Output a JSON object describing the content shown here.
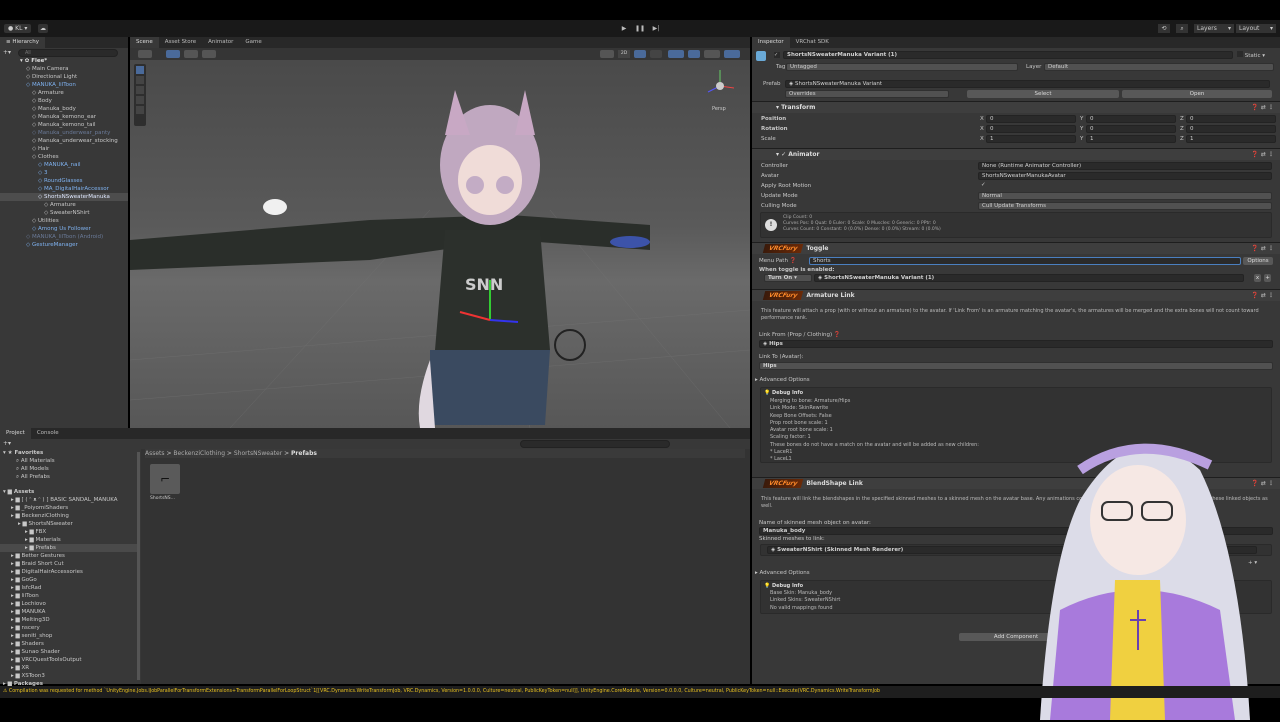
{
  "toolbar": {
    "account": "KL",
    "layers": "Layers",
    "layout": "Layout"
  },
  "hierarchy": {
    "title": "Hierarchy",
    "search_placeholder": "All",
    "scene": "Flee*",
    "items": [
      {
        "label": "Main Camera",
        "depth": 1,
        "kind": "object"
      },
      {
        "label": "Directional Light",
        "depth": 1,
        "kind": "object"
      },
      {
        "label": "MANUKA_lilToon",
        "depth": 1,
        "kind": "prefab"
      },
      {
        "label": "Armature",
        "depth": 2,
        "kind": "object"
      },
      {
        "label": "Body",
        "depth": 2,
        "kind": "object"
      },
      {
        "label": "Manuka_body",
        "depth": 2,
        "kind": "object"
      },
      {
        "label": "Manuka_kemono_ear",
        "depth": 2,
        "kind": "object"
      },
      {
        "label": "Manuka_kemono_tail",
        "depth": 2,
        "kind": "object"
      },
      {
        "label": "Manuka_underwear_panty",
        "depth": 2,
        "kind": "disabled"
      },
      {
        "label": "Manuka_underwear_stocking",
        "depth": 2,
        "kind": "object"
      },
      {
        "label": "Hair",
        "depth": 2,
        "kind": "object"
      },
      {
        "label": "Clothes",
        "depth": 2,
        "kind": "object"
      },
      {
        "label": "MANUKA_nail",
        "depth": 3,
        "kind": "prefab"
      },
      {
        "label": "3",
        "depth": 3,
        "kind": "prefab"
      },
      {
        "label": "RoundGlasses",
        "depth": 3,
        "kind": "prefab"
      },
      {
        "label": "MA_DigitalHairAccessor",
        "depth": 3,
        "kind": "prefab"
      },
      {
        "label": "ShortsNSweaterManuka",
        "depth": 3,
        "kind": "selected"
      },
      {
        "label": "Armature",
        "depth": 4,
        "kind": "object"
      },
      {
        "label": "SweaterNShirt",
        "depth": 4,
        "kind": "object"
      },
      {
        "label": "Utilities",
        "depth": 2,
        "kind": "object"
      },
      {
        "label": "Among Us Follower",
        "depth": 2,
        "kind": "prefab"
      },
      {
        "label": "MANUKA_lilToon (Android)",
        "depth": 1,
        "kind": "disabled"
      },
      {
        "label": "GestureManager",
        "depth": 1,
        "kind": "prefab"
      }
    ]
  },
  "scene": {
    "tabs": [
      "Scene",
      "Asset Store",
      "Animator",
      "Game"
    ],
    "gizmo_label": "Persp",
    "mode_2d": "2D"
  },
  "inspector": {
    "tabs": [
      "Inspector",
      "VRChat SDK"
    ],
    "object_name": "ShortsNSweaterManuka Variant (1)",
    "static_label": "Static",
    "tag_label": "Tag",
    "tag": "Untagged",
    "layer_label": "Layer",
    "layer": "Default",
    "prefab_label": "Prefab",
    "prefab": "ShortsNSweaterManuka Variant",
    "overrides": "Overrides",
    "select": "Select",
    "open": "Open",
    "transform": {
      "title": "Transform",
      "rows": [
        {
          "label": "Position",
          "x": "0",
          "y": "0",
          "z": "0"
        },
        {
          "label": "Rotation",
          "x": "0",
          "y": "0",
          "z": "0"
        },
        {
          "label": "Scale",
          "x": "1",
          "y": "1",
          "z": "1"
        }
      ]
    },
    "animator": {
      "title": "Animator",
      "rows": [
        {
          "label": "Controller",
          "value": "None (Runtime Animator Controller)"
        },
        {
          "label": "Avatar",
          "value": "ShortsNSweaterManukaAvatar"
        },
        {
          "label": "Apply Root Motion",
          "value": "✓"
        },
        {
          "label": "Update Mode",
          "value": "Normal"
        },
        {
          "label": "Culling Mode",
          "value": "Cull Update Transforms"
        }
      ],
      "info": [
        "Clip Count: 0",
        "Curves Pos: 0 Quat: 0 Euler: 0 Scale: 0 Muscles: 0 Generic: 0 PPtr: 0",
        "Curves Count: 0 Constant: 0 (0.0%) Dense: 0 (0.0%) Stream: 0 (0.0%)"
      ]
    },
    "vrcfury_badge": "VRCFury",
    "toggle": {
      "title": "Toggle",
      "menu_path_label": "Menu Path",
      "menu_path": "Shorts",
      "options": "Options",
      "when_enabled": "When toggle is enabled:",
      "action": "Turn On",
      "target": "ShortsNSweaterManuka Variant (1)"
    },
    "armature_link": {
      "title": "Armature Link",
      "description": "This feature will attach a prop (with or without an armature) to the avatar. If 'Link From' is an armature matching the avatar's, the armatures will be merged and the extra bones will not count toward performance rank.",
      "link_from_label": "Link From (Prop / Clothing)",
      "link_from": "Hips",
      "link_to_label": "Link To (Avatar):",
      "link_to": "Hips",
      "advanced": "Advanced Options",
      "debug_title": "Debug Info",
      "debug": [
        "Merging to bone: Armature/Hips",
        "Link Mode: SkinRewrite",
        "Keep Bone Offsets: False",
        "Prop root bone scale: 1",
        "Avatar root bone scale: 1",
        "Scaling factor: 1",
        "These bones do not have a match on the avatar and will be added as new children:",
        "* LaceR1",
        "* LaceL1"
      ]
    },
    "blendshape_link": {
      "title": "BlendShape Link",
      "description": "This feature will link the blendshapes in the specified skinned meshes to a skinned mesh on the avatar base. Any animations controlling the blendshape will be updated to control these linked objects as well.",
      "name_label": "Name of skinned mesh object on avatar:",
      "name": "Manuka_body",
      "meshes_label": "Skinned meshes to link:",
      "mesh": "SweaterNShirt (Skinned Mesh Renderer)",
      "advanced": "Advanced Options",
      "debug_title": "Debug Info",
      "debug": [
        "Base Skin: Manuka_body",
        "Linked Skins: SweaterNShirt",
        "No valid mappings found"
      ]
    },
    "add_component": "Add Component"
  },
  "project": {
    "tabs": [
      "Project",
      "Console"
    ],
    "favorites": "Favorites",
    "fav_items": [
      "All Materials",
      "All Models",
      "All Prefabs"
    ],
    "assets": "Assets",
    "tree": [
      {
        "label": "[ ( ᵔ ᴥ ᵔ ) ] BASIC SANDAL_MANUKA",
        "depth": 1
      },
      {
        "label": "_PoiyomiShaders",
        "depth": 1
      },
      {
        "label": "BeckenziClothing",
        "depth": 1
      },
      {
        "label": "ShortsNSweater",
        "depth": 2
      },
      {
        "label": "FBX",
        "depth": 3
      },
      {
        "label": "Materials",
        "depth": 3
      },
      {
        "label": "Prefabs",
        "depth": 3,
        "selected": true
      },
      {
        "label": "Better Gestures",
        "depth": 1
      },
      {
        "label": "Braid Short Cut",
        "depth": 1
      },
      {
        "label": "DigitalHairAccessories",
        "depth": 1
      },
      {
        "label": "GoGo",
        "depth": 1
      },
      {
        "label": "lsfcRad",
        "depth": 1
      },
      {
        "label": "lilToon",
        "depth": 1
      },
      {
        "label": "Lochiovo",
        "depth": 1
      },
      {
        "label": "MANUKA",
        "depth": 1
      },
      {
        "label": "Melting3D",
        "depth": 1
      },
      {
        "label": "nscery",
        "depth": 1
      },
      {
        "label": "seniti_shop",
        "depth": 1
      },
      {
        "label": "Shaders",
        "depth": 1
      },
      {
        "label": "Sunao Shader",
        "depth": 1
      },
      {
        "label": "VRCQuestToolsOutput",
        "depth": 1
      },
      {
        "label": "XR",
        "depth": 1
      },
      {
        "label": "XSToon3",
        "depth": 1
      }
    ],
    "packages": "Packages",
    "breadcrumb": [
      "Assets",
      "BeckenziClothing",
      "ShortsNSweater",
      "Prefabs"
    ],
    "asset": "ShortsNS..."
  },
  "status": {
    "message": "Compilation was requested for method `UnityEngine.Jobs.IJobParallelForTransformExtensions+TransformParallelForLoopStruct`1[[VRC.Dynamics.WriteTransformJob, VRC.Dynamics, Version=1.0.0.0, Culture=neutral, PublicKeyToken=null]], UnityEngine.CoreModule, Version=0.0.0.0, Culture=neutral, PublicKeyToken=null::Execute(VRC.Dynamics.WriteTransformJob"
  },
  "colors": {
    "accent": "#4a7fc0",
    "prefab_text": "#7fb2f0",
    "vrcfury": "#ff8a2a",
    "warning": "#e8c020"
  }
}
